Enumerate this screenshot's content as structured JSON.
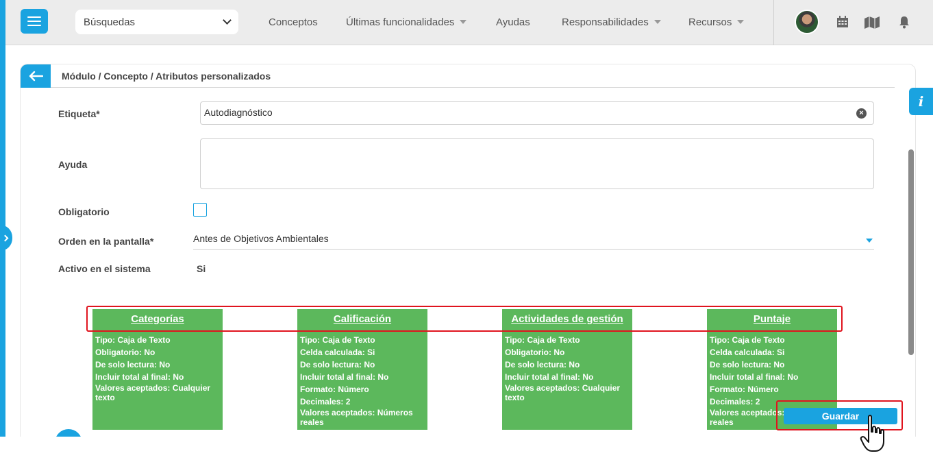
{
  "topbar": {
    "search_select": "Búsquedas",
    "nav": [
      {
        "label": "Conceptos"
      },
      {
        "label": "Últimas funcionalidades"
      },
      {
        "label": "Ayudas"
      },
      {
        "label": "Responsabilidades"
      },
      {
        "label": "Recursos"
      }
    ],
    "icons": [
      "menu-icon",
      "calendar-icon",
      "map-icon",
      "bell-icon"
    ]
  },
  "card": {
    "breadcrumb": "Módulo / Concepto / Atributos personalizados",
    "form": {
      "etiqueta_label": "Etiqueta*",
      "etiqueta_value": "Autodiagnóstico",
      "ayuda_label": "Ayuda",
      "ayuda_value": "",
      "obligatorio_label": "Obligatorio",
      "orden_label": "Orden en la pantalla*",
      "orden_value": "Antes de Objetivos Ambientales",
      "activo_label": "Activo en el sistema",
      "activo_value": "Si"
    },
    "columns": [
      {
        "title": "Categorías",
        "lines": [
          "Tipo: Caja de Texto",
          "Obligatorio: No",
          "De solo lectura: No",
          "Incluir total al final: No",
          "Valores aceptados: Cualquier texto"
        ]
      },
      {
        "title": "Calificación",
        "lines": [
          "Tipo: Caja de Texto",
          "Celda calculada: Si",
          "De solo lectura: No",
          "Incluir total al final: No",
          "Formato: Número",
          "Decimales: 2",
          "Valores aceptados: Números reales"
        ]
      },
      {
        "title": "Actividades de gestión",
        "lines": [
          "Tipo: Caja de Texto",
          "Obligatorio: No",
          "De solo lectura: No",
          "Incluir total al final: No",
          "Valores aceptados: Cualquier texto"
        ]
      },
      {
        "title": "Puntaje",
        "lines": [
          "Tipo: Caja de Texto",
          "Celda calculada: Si",
          "De solo lectura: No",
          "Incluir total al final: No",
          "Formato: Número",
          "Decimales: 2",
          "Valores aceptados: Números reales"
        ]
      }
    ],
    "save_label": "Guardar"
  },
  "info_label": "i",
  "colors": {
    "accent": "#1aa3e0",
    "column": "#5cb85c",
    "highlight": "#e0141e"
  }
}
